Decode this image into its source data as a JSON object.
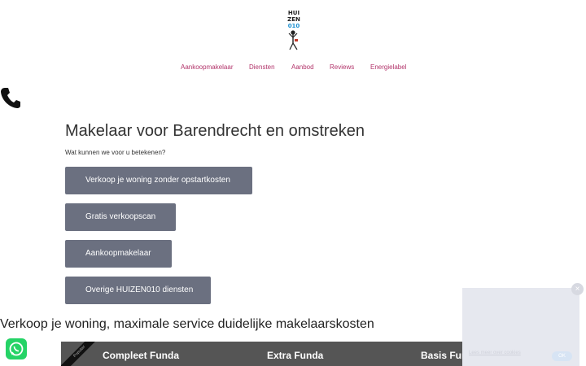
{
  "logo": {
    "lines": [
      "HUI",
      "ZEN",
      "010"
    ],
    "alt": "HUIZEN010"
  },
  "nav": {
    "items": [
      {
        "label": "Aankoopmakelaar"
      },
      {
        "label": "Diensten"
      },
      {
        "label": "Aanbod"
      },
      {
        "label": "Reviews"
      },
      {
        "label": "Energielabel"
      }
    ]
  },
  "hero": {
    "title": "Makelaar voor Barendrecht en omstreken",
    "subtitle": "Wat kunnen we voor u betekenen?",
    "buttons": [
      {
        "label": "Verkoop je woning zonder opstartkosten"
      },
      {
        "label": "Gratis verkoopscan"
      },
      {
        "label": "Aankoopmakelaar"
      },
      {
        "label": "Overige HUIZEN010 diensten"
      }
    ]
  },
  "section": {
    "heading": "Verkoop je woning, maximale service duidelijke makelaarskosten"
  },
  "pricing": {
    "ribbon": "Populair",
    "columns": [
      {
        "label": "Compleet Funda"
      },
      {
        "label": "Extra Funda"
      },
      {
        "label": "Basis Funda"
      }
    ]
  },
  "cookie": {
    "close": "×",
    "link": "Lees meer over cookies",
    "ok": "OK"
  },
  "colors": {
    "nav": "#b2336a",
    "button": "#6b7080",
    "whatsapp": "#25d366",
    "pricing_bar": "#555555"
  },
  "icons": {
    "phone": "phone-icon",
    "whatsapp": "whatsapp-icon"
  }
}
